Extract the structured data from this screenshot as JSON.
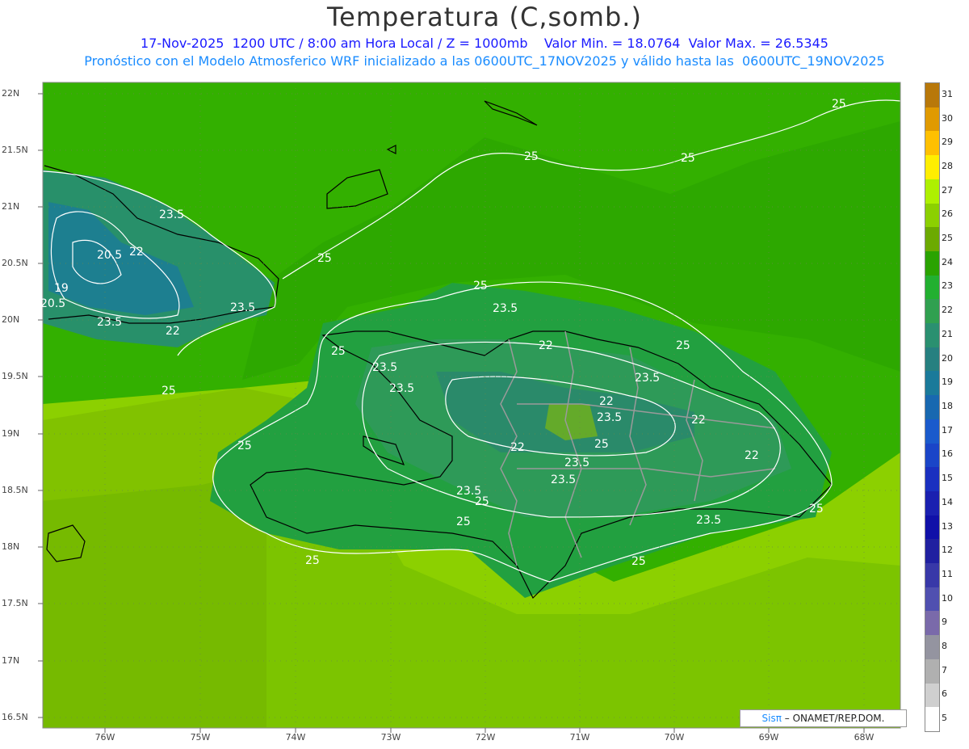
{
  "header": {
    "title": "Temperatura (C,somb.)",
    "line1": "17-Nov-2025  1200 UTC / 8:00 am Hora Local / Z = 1000mb    Valor Min. = 18.0764  Valor Max. = 26.5345",
    "line2": "Pronóstico con el Modelo Atmosferico WRF inicializado a las 0600UTC_17NOV2025 y válido hasta las  0600UTC_19NOV2025"
  },
  "axes": {
    "y_labels": [
      "22N",
      "21.5N",
      "21N",
      "20.5N",
      "20N",
      "19.5N",
      "19N",
      "18.5N",
      "18N",
      "17.5N",
      "17N",
      "16.5N"
    ],
    "x_labels": [
      "76W",
      "75W",
      "74W",
      "73W",
      "72W",
      "71W",
      "70W",
      "69W",
      "68W"
    ]
  },
  "contour_labels": [
    "25",
    "25",
    "25",
    "23.5",
    "25",
    "22",
    "20.5",
    "19",
    "20.5",
    "23.5",
    "23.5",
    "22",
    "25",
    "25",
    "23.5",
    "25",
    "23.5",
    "22",
    "23.5",
    "22",
    "25",
    "23.5",
    "22",
    "25",
    "22",
    "23.5",
    "25",
    "23.5",
    "25",
    "23.5",
    "23.5",
    "25",
    "25",
    "25",
    "23.5",
    "25",
    "22",
    "25"
  ],
  "legend": {
    "levels": [
      "31",
      "30",
      "29",
      "28",
      "27",
      "26",
      "25",
      "24",
      "23",
      "22",
      "21",
      "20",
      "19",
      "18",
      "17",
      "16",
      "15",
      "14",
      "13",
      "12",
      "11",
      "10",
      "9",
      "8",
      "7",
      "6",
      "5"
    ],
    "colors": [
      "#b8780a",
      "#e09a00",
      "#ffc000",
      "#ffee00",
      "#aef000",
      "#8cd000",
      "#6caa00",
      "#2aa300",
      "#22b030",
      "#30a050",
      "#2a9070",
      "#268080",
      "#1a7a9a",
      "#1868b0",
      "#1a5acc",
      "#1a45c8",
      "#1a30c0",
      "#1a20b0",
      "#1010a8",
      "#2020a0",
      "#3838a8",
      "#5050b0",
      "#7a6aaa",
      "#9494a0",
      "#b0b0b0",
      "#cfcfcf",
      "#ffffff"
    ]
  },
  "credit": {
    "sis": "Sisπ",
    "text": " – ONAMET/REP.DOM."
  }
}
